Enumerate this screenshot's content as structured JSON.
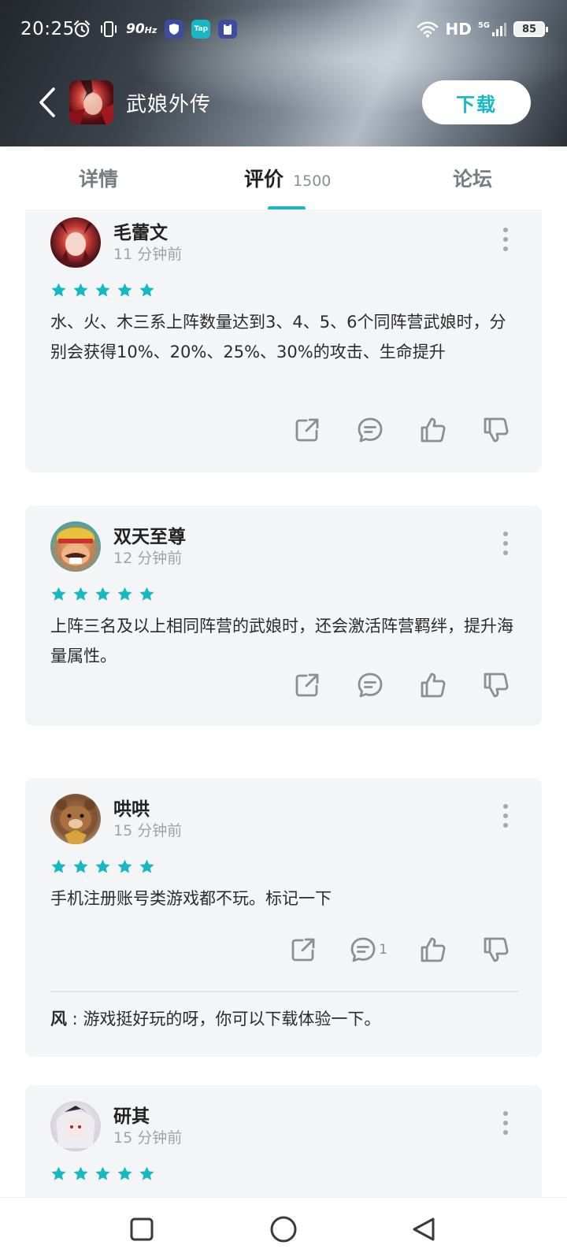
{
  "status_bar": {
    "time": "20:25",
    "refresh_rate": "90",
    "refresh_unit": "Hz",
    "mini_app_label": "Tap",
    "network": "HD",
    "network_gen": "5G",
    "battery": "85"
  },
  "app_bar": {
    "title": "武娘外传",
    "download_label": "下载"
  },
  "tabs": {
    "details": "详情",
    "reviews": "评价",
    "reviews_count": "1500",
    "forum": "论坛"
  },
  "reviews": [
    {
      "username": "毛蕾文",
      "time": "11 分钟前",
      "rating": 5,
      "text": "水、火、木三系上阵数量达到3、4、5、6个同阵营武娘时，分别会获得10%、20%、25%、30%的攻击、生命提升"
    },
    {
      "username": "双天至尊",
      "time": "12 分钟前",
      "rating": 5,
      "text": "上阵三名及以上相同阵营的武娘时，还会激活阵营羁绊，提升海量属性。"
    },
    {
      "username": "哄哄",
      "time": "15 分钟前",
      "rating": 5,
      "text": "手机注册账号类游戏都不玩。标记一下",
      "comment_count": "1",
      "reply_author": "风",
      "reply_sep": " : ",
      "reply_text": "游戏挺好玩的呀，你可以下载体验一下。"
    },
    {
      "username": "研其",
      "time": "15 分钟前",
      "rating": 5
    }
  ],
  "colors": {
    "accent": "#16b8c4",
    "card_bg": "#f4f5f7",
    "icon_gray": "#8a8f94"
  },
  "icons": [
    "back-icon",
    "alarm-icon",
    "vibrate-icon",
    "wifi-icon",
    "signal-icon",
    "battery-icon",
    "star-icon",
    "share-icon",
    "comment-icon",
    "thumbs-up-icon",
    "thumbs-down-icon",
    "more-icon",
    "recents-icon",
    "home-icon",
    "back-nav-icon"
  ]
}
